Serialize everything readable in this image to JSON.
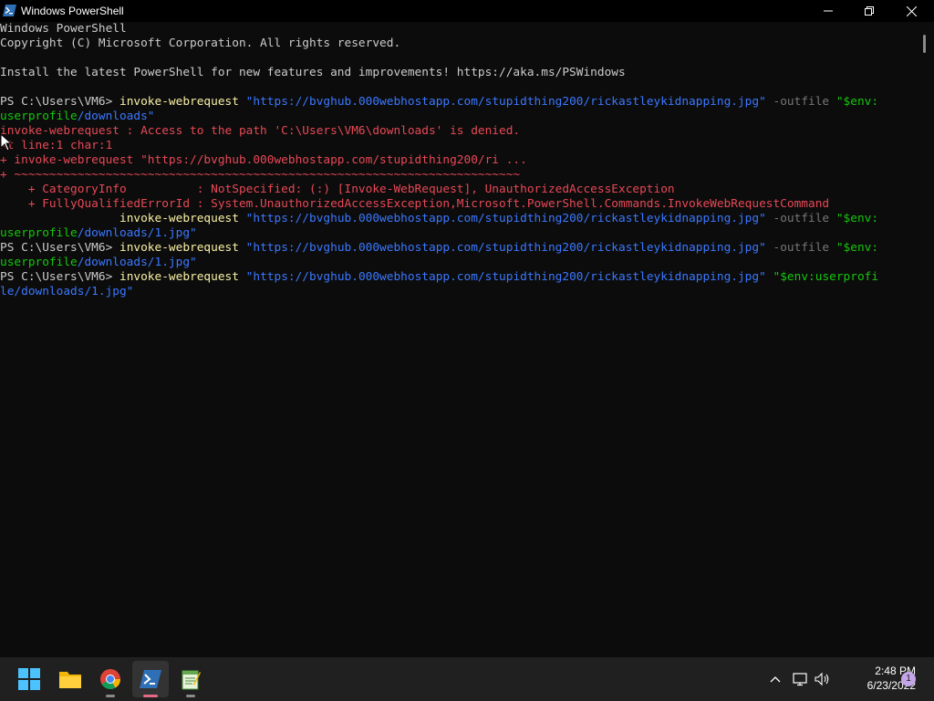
{
  "window": {
    "title": "Windows PowerShell"
  },
  "console": {
    "lines": [
      [
        {
          "t": "Windows PowerShell",
          "c": "w"
        }
      ],
      [
        {
          "t": "Copyright (C) Microsoft Corporation. All rights reserved.",
          "c": "w"
        }
      ],
      [],
      [
        {
          "t": "Install the latest PowerShell for new features and improvements! https://aka.ms/PSWindows",
          "c": "w"
        }
      ],
      [],
      [
        {
          "t": "PS C:\\Users\\VM6> ",
          "c": "w"
        },
        {
          "t": "invoke-webrequest ",
          "c": "y"
        },
        {
          "t": "\"https://bvghub.000webhostapp.com/stupidthing200/rickastleykidnapping.jpg\"",
          "c": "b"
        },
        {
          "t": " -outfile ",
          "c": "g"
        },
        {
          "t": "\"$env:",
          "c": "grn"
        }
      ],
      [
        {
          "t": "userprofile",
          "c": "grn"
        },
        {
          "t": "/downloads\"",
          "c": "b"
        }
      ],
      [
        {
          "t": "invoke-webrequest : Access to the path 'C:\\Users\\VM6\\downloads' is denied.",
          "c": "r"
        }
      ],
      [
        {
          "t": "At line:1 char:1",
          "c": "r"
        }
      ],
      [
        {
          "t": "+ invoke-webrequest \"https://bvghub.000webhostapp.com/stupidthing200/ri ...",
          "c": "r"
        }
      ],
      [
        {
          "t": "+ ~~~~~~~~~~~~~~~~~~~~~~~~~~~~~~~~~~~~~~~~~~~~~~~~~~~~~~~~~~~~~~~~~~~~~~~~",
          "c": "r"
        }
      ],
      [
        {
          "t": "    + CategoryInfo          : NotSpecified: (:) [Invoke-WebRequest], UnauthorizedAccessException",
          "c": "r"
        }
      ],
      [
        {
          "t": "    + FullyQualifiedErrorId : System.UnauthorizedAccessException,Microsoft.PowerShell.Commands.InvokeWebRequestCommand",
          "c": "r"
        }
      ],
      [
        {
          "t": "                 ",
          "c": "w"
        },
        {
          "t": "invoke-webrequest ",
          "c": "y"
        },
        {
          "t": "\"https://bvghub.000webhostapp.com/stupidthing200/rickastleykidnapping.jpg\"",
          "c": "b"
        },
        {
          "t": " -outfile ",
          "c": "g"
        },
        {
          "t": "\"$env:",
          "c": "grn"
        }
      ],
      [
        {
          "t": "userprofile",
          "c": "grn"
        },
        {
          "t": "/downloads/1.jpg\"",
          "c": "b"
        }
      ],
      [
        {
          "t": "PS C:\\Users\\VM6> ",
          "c": "w"
        },
        {
          "t": "invoke-webrequest ",
          "c": "y"
        },
        {
          "t": "\"https://bvghub.000webhostapp.com/stupidthing200/rickastleykidnapping.jpg\"",
          "c": "b"
        },
        {
          "t": " -outfile ",
          "c": "g"
        },
        {
          "t": "\"$env:",
          "c": "grn"
        }
      ],
      [
        {
          "t": "userprofile",
          "c": "grn"
        },
        {
          "t": "/downloads/1.jpg\"",
          "c": "b"
        }
      ],
      [
        {
          "t": "PS C:\\Users\\VM6> ",
          "c": "w"
        },
        {
          "t": "invoke-webrequest ",
          "c": "y"
        },
        {
          "t": "\"https://bvghub.000webhostapp.com/stupidthing200/rickastleykidnapping.jpg\"",
          "c": "b"
        },
        {
          "t": " ",
          "c": "w"
        },
        {
          "t": "\"$env:userprofi",
          "c": "grn"
        }
      ],
      [
        {
          "t": "le/downloads/1.jpg\"",
          "c": "b"
        }
      ]
    ]
  },
  "taskbar": {
    "time": "2:48 PM",
    "date": "6/23/2022",
    "notification_count": "1",
    "apps": [
      "start-icon",
      "file-explorer-icon",
      "chrome-icon",
      "powershell-icon",
      "notepad-icon"
    ]
  },
  "colors": {
    "console_bg": "#0c0c0c",
    "default_fg": "#cccccc",
    "command": "#f9f1a5",
    "string": "#3b78ff",
    "parameter": "#767676",
    "variable": "#16c60c",
    "error": "#e74856",
    "taskbar_bg": "#202020",
    "active_indicator": "#e56a88"
  }
}
